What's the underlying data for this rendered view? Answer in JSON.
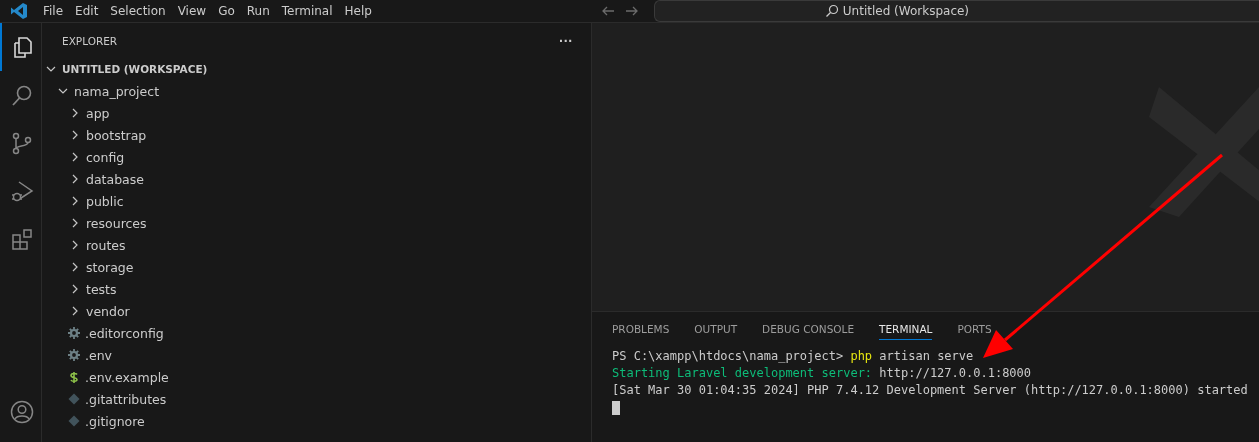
{
  "menu": [
    "File",
    "Edit",
    "Selection",
    "View",
    "Go",
    "Run",
    "Terminal",
    "Help"
  ],
  "command_center": {
    "label": "Untitled (Workspace)"
  },
  "activity_bar": [
    {
      "kind": "explorer",
      "selected": true
    },
    {
      "kind": "search",
      "selected": false
    },
    {
      "kind": "source-control",
      "selected": false
    },
    {
      "kind": "run-debug",
      "selected": false
    },
    {
      "kind": "extensions",
      "selected": false
    }
  ],
  "sidebar": {
    "title": "EXPLORER",
    "more": "···",
    "tree": [
      {
        "label": "UNTITLED (WORKSPACE)",
        "kind": "root",
        "expanded": true,
        "children": [
          {
            "label": "nama_project",
            "kind": "folder",
            "expanded": true,
            "children": [
              {
                "label": "app",
                "kind": "folder",
                "expanded": false
              },
              {
                "label": "bootstrap",
                "kind": "folder",
                "expanded": false
              },
              {
                "label": "config",
                "kind": "folder",
                "expanded": false
              },
              {
                "label": "database",
                "kind": "folder",
                "expanded": false
              },
              {
                "label": "public",
                "kind": "folder",
                "expanded": false
              },
              {
                "label": "resources",
                "kind": "folder",
                "expanded": false
              },
              {
                "label": "routes",
                "kind": "folder",
                "expanded": false
              },
              {
                "label": "storage",
                "kind": "folder",
                "expanded": false
              },
              {
                "label": "tests",
                "kind": "folder",
                "expanded": false
              },
              {
                "label": "vendor",
                "kind": "folder",
                "expanded": false
              },
              {
                "label": ".editorconfig",
                "kind": "settings-file"
              },
              {
                "label": ".env",
                "kind": "settings-file"
              },
              {
                "label": ".env.example",
                "kind": "shell-file"
              },
              {
                "label": ".gitattributes",
                "kind": "git-file"
              },
              {
                "label": ".gitignore",
                "kind": "git-file"
              }
            ]
          }
        ]
      }
    ]
  },
  "panel": {
    "tabs": [
      {
        "label": "PROBLEMS",
        "selected": false
      },
      {
        "label": "OUTPUT",
        "selected": false
      },
      {
        "label": "DEBUG CONSOLE",
        "selected": false
      },
      {
        "label": "TERMINAL",
        "selected": true
      },
      {
        "label": "PORTS",
        "selected": false
      }
    ],
    "terminal_lines": [
      [
        {
          "text": "PS C:\\xampp\\htdocs\\nama_project> ",
          "color": "#cccccc"
        },
        {
          "text": "php",
          "color": "#e5e510"
        },
        {
          "text": " artisan serve",
          "color": "#cccccc"
        }
      ],
      [
        {
          "text": "Starting Laravel development server:",
          "color": "#0dbc79"
        },
        {
          "text": " http://127.0.0.1:8000",
          "color": "#cccccc"
        }
      ],
      [
        {
          "text": "[Sat Mar 30 01:04:35 2024] PHP 7.4.12 Development Server (http://127.0.0.1:8000) started",
          "color": "#cccccc"
        }
      ]
    ]
  }
}
